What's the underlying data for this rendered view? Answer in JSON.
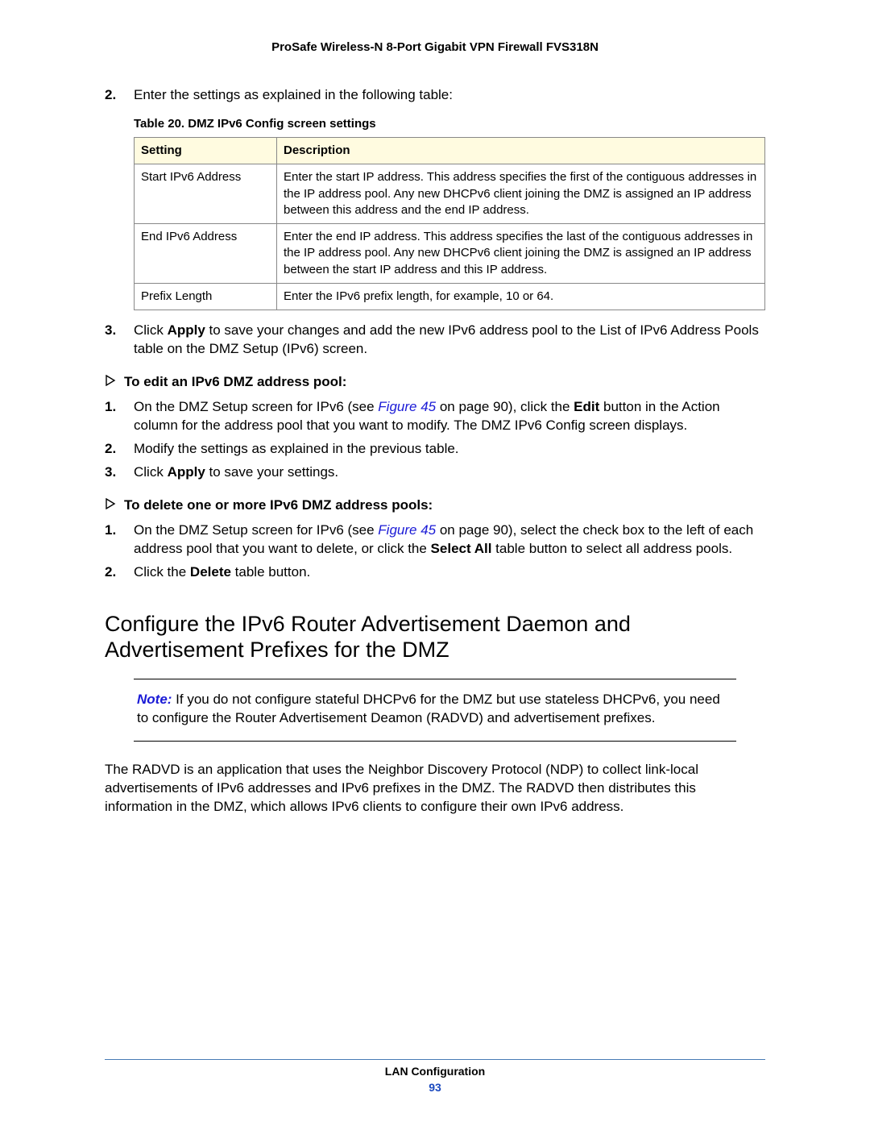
{
  "header": {
    "title": "ProSafe Wireless-N 8-Port Gigabit VPN Firewall FVS318N"
  },
  "step2": {
    "num": "2.",
    "text": "Enter the settings as explained in the following table:"
  },
  "table20": {
    "caption": "Table 20.  DMZ IPv6 Config screen settings",
    "headers": {
      "c0": "Setting",
      "c1": "Description"
    },
    "rows": [
      {
        "c0": "Start IPv6 Address",
        "c1": "Enter the start IP address. This address specifies the first of the contiguous addresses in the IP address pool. Any new DHCPv6 client joining the DMZ is assigned an IP address between this address and the end IP address."
      },
      {
        "c0": "End IPv6 Address",
        "c1": "Enter the end IP address. This address specifies the last of the contiguous addresses in the IP address pool. Any new DHCPv6 client joining the DMZ is assigned an IP address between the start IP address and this IP address."
      },
      {
        "c0": "Prefix Length",
        "c1": "Enter the IPv6 prefix length, for example, 10 or 64."
      }
    ]
  },
  "step3": {
    "num": "3.",
    "pre": "Click ",
    "apply": "Apply",
    "post": " to save your changes and add the new IPv6 address pool to the List of IPv6 Address Pools table on the DMZ Setup (IPv6) screen."
  },
  "task_edit": {
    "title": "To edit an IPv6 DMZ address pool:",
    "s1": {
      "num": "1.",
      "a": "On the DMZ Setup screen for IPv6 (see ",
      "link": "Figure 45",
      "b": " on page 90), click the ",
      "edit": "Edit",
      "c": " button in the Action column for the address pool that you want to modify. The DMZ IPv6 Config screen displays."
    },
    "s2": {
      "num": "2.",
      "text": "Modify the settings as explained in the previous table."
    },
    "s3": {
      "num": "3.",
      "a": "Click ",
      "apply": "Apply",
      "b": " to save your settings."
    }
  },
  "task_delete": {
    "title": "To delete one or more IPv6 DMZ address pools:",
    "s1": {
      "num": "1.",
      "a": "On the DMZ Setup screen for IPv6 (see ",
      "link": "Figure 45",
      "b": " on page 90), select the check box to the left of each address pool that you want to delete, or click the ",
      "selectall": "Select All",
      "c": " table button to select all address pools."
    },
    "s2": {
      "num": "2.",
      "a": "Click the ",
      "delete": "Delete",
      "b": " table button."
    }
  },
  "h2": {
    "text": "Configure the IPv6 Router Advertisement Daemon and Advertisement Prefixes for the DMZ"
  },
  "note": {
    "label": "Note:",
    "body": "  If you do not configure stateful DHCPv6 for the DMZ but use stateless DHCPv6, you need to configure the Router Advertisement Deamon (RADVD) and advertisement prefixes."
  },
  "para": {
    "text": "The RADVD is an application that uses the Neighbor Discovery Protocol (NDP) to collect link-local advertisements of IPv6 addresses and IPv6 prefixes in the DMZ. The RADVD then distributes this information in the DMZ, which allows IPv6 clients to configure their own IPv6 address."
  },
  "footer": {
    "section": "LAN Configuration",
    "page": "93"
  }
}
